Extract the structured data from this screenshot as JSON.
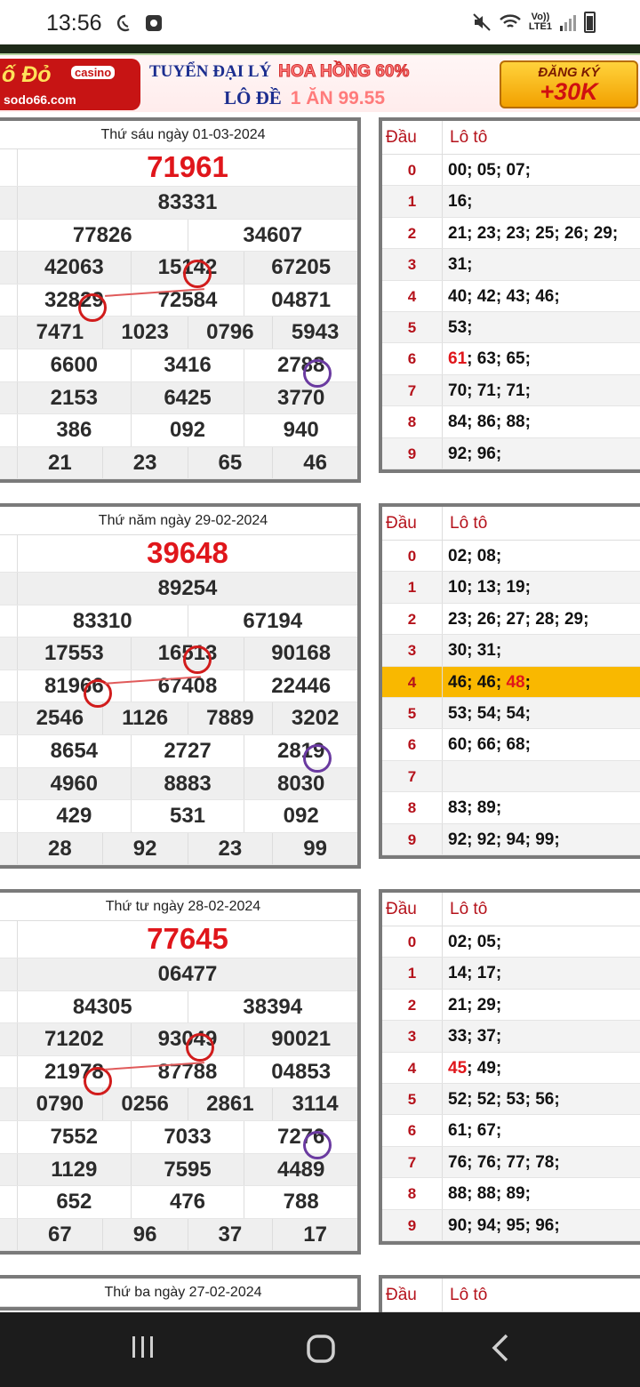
{
  "status_bar": {
    "time": "13:56",
    "network_top": "Vo))",
    "network_bottom": "LTE1",
    "icons": [
      "whatsapp-icon",
      "app-icon",
      "mute-icon",
      "wifi-icon",
      "signal-icon",
      "battery-icon"
    ]
  },
  "ad": {
    "brand": "ố Đỏ",
    "casino": "casino",
    "domain": "sodo66.com",
    "line1_a": "TUYỂN ĐẠI LÝ",
    "line1_b": "HOA HỒNG 60%",
    "line2_a": "LÔ ĐỀ",
    "line2_b": "1 ĂN 99.55",
    "cta_top": "ĐĂNG KÝ",
    "cta_bottom": "+30K"
  },
  "loto_header": {
    "dau": "Đầu",
    "loto": "Lô tô"
  },
  "days": [
    {
      "date": "Thứ sáu ngày 01-03-2024",
      "special": "71961",
      "rows": [
        [
          "83331"
        ],
        [
          "77826",
          "34607"
        ],
        [
          "42063",
          "15142",
          "67205"
        ],
        [
          "32829",
          "72584",
          "04871"
        ],
        [
          "7471",
          "1023",
          "0796",
          "5943"
        ],
        [
          "6600",
          "3416",
          "2788"
        ],
        [
          "2153",
          "6425",
          "3770"
        ],
        [
          "386",
          "092",
          "940"
        ],
        [
          "21",
          "23",
          "65",
          "46"
        ]
      ],
      "loto": [
        {
          "d": "0",
          "v": "00; 05; 07;"
        },
        {
          "d": "1",
          "v": "16;"
        },
        {
          "d": "2",
          "v": "21; 23; 23; 25; 26; 29;"
        },
        {
          "d": "3",
          "v": "31;"
        },
        {
          "d": "4",
          "v": "40; 42; 43; 46;"
        },
        {
          "d": "5",
          "v": "53;"
        },
        {
          "d": "6",
          "red": "61",
          "v": "; 63; 65;"
        },
        {
          "d": "7",
          "v": "70; 71; 71;"
        },
        {
          "d": "8",
          "v": "84; 86; 88;"
        },
        {
          "d": "9",
          "v": "92; 96;"
        }
      ]
    },
    {
      "date": "Thứ năm ngày 29-02-2024",
      "special": "39648",
      "rows": [
        [
          "89254"
        ],
        [
          "83310",
          "67194"
        ],
        [
          "17553",
          "16513",
          "90168"
        ],
        [
          "81966",
          "67408",
          "22446"
        ],
        [
          "2546",
          "1126",
          "7889",
          "3202"
        ],
        [
          "8654",
          "2727",
          "2819"
        ],
        [
          "4960",
          "8883",
          "8030"
        ],
        [
          "429",
          "531",
          "092"
        ],
        [
          "28",
          "92",
          "23",
          "99"
        ]
      ],
      "loto": [
        {
          "d": "0",
          "v": "02; 08;"
        },
        {
          "d": "1",
          "v": "10; 13; 19;"
        },
        {
          "d": "2",
          "v": "23; 26; 27; 28; 29;"
        },
        {
          "d": "3",
          "v": "30; 31;"
        },
        {
          "d": "4",
          "v": "46; 46; ",
          "red": "48",
          "after": ";"
        },
        {
          "d": "5",
          "v": "53; 54; 54;"
        },
        {
          "d": "6",
          "v": "60; 66; 68;"
        },
        {
          "d": "7",
          "v": ""
        },
        {
          "d": "8",
          "v": "83; 89;"
        },
        {
          "d": "9",
          "v": "92; 92; 94; 99;"
        }
      ]
    },
    {
      "date": "Thứ tư ngày 28-02-2024",
      "special": "77645",
      "rows": [
        [
          "06477"
        ],
        [
          "84305",
          "38394"
        ],
        [
          "71202",
          "93049",
          "90021"
        ],
        [
          "21978",
          "87788",
          "04853"
        ],
        [
          "0790",
          "0256",
          "2861",
          "3114"
        ],
        [
          "7552",
          "7033",
          "7276"
        ],
        [
          "1129",
          "7595",
          "4489"
        ],
        [
          "652",
          "476",
          "788"
        ],
        [
          "67",
          "96",
          "37",
          "17"
        ]
      ],
      "loto": [
        {
          "d": "0",
          "v": "02; 05;"
        },
        {
          "d": "1",
          "v": "14; 17;"
        },
        {
          "d": "2",
          "v": "21; 29;"
        },
        {
          "d": "3",
          "v": "33; 37;"
        },
        {
          "d": "4",
          "red": "45",
          "v": "; 49;"
        },
        {
          "d": "5",
          "v": "52; 52; 53; 56;"
        },
        {
          "d": "6",
          "v": "61; 67;"
        },
        {
          "d": "7",
          "v": "76; 76; 77; 78;"
        },
        {
          "d": "8",
          "v": "88; 88; 89;"
        },
        {
          "d": "9",
          "v": "90; 94; 95; 96;"
        }
      ]
    },
    {
      "date": "Thứ ba ngày 27-02-2024"
    }
  ],
  "nav": {
    "recents": "recents-icon",
    "home": "home-icon",
    "back": "back-icon"
  }
}
